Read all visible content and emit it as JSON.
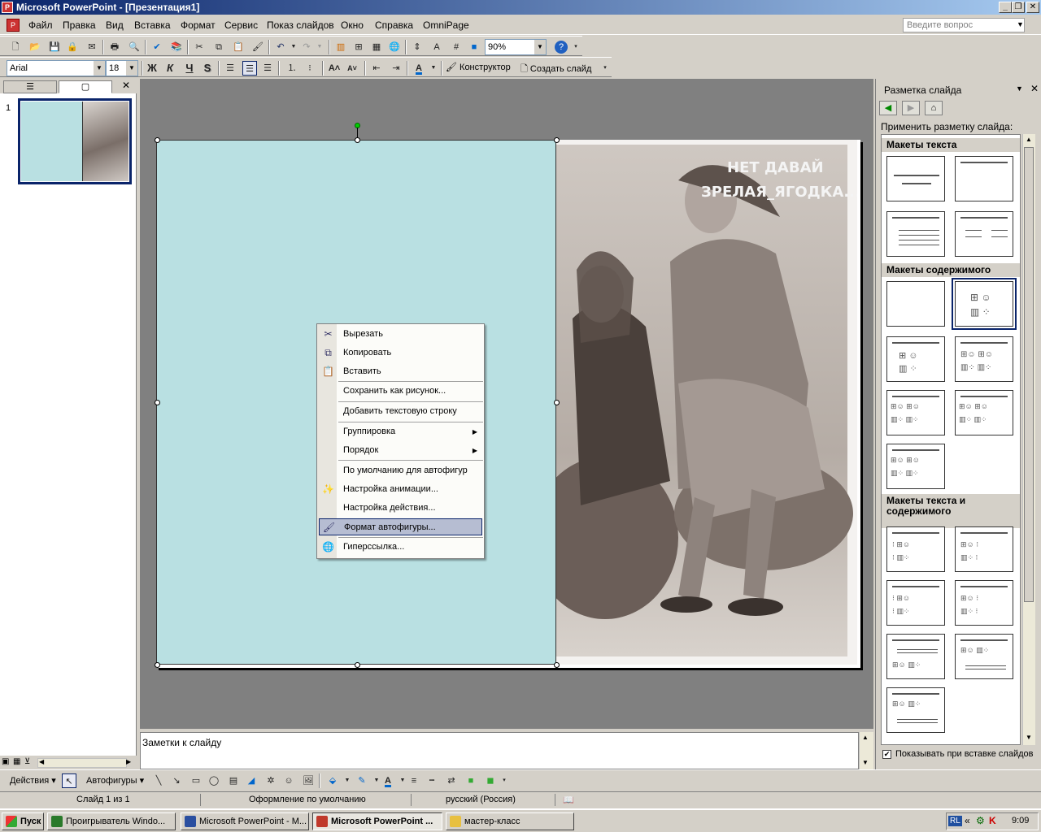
{
  "window": {
    "title": "Microsoft PowerPoint - [Презентация1]",
    "controls": [
      "_",
      "❐",
      "✕"
    ]
  },
  "menubar": {
    "items": [
      "Файл",
      "Правка",
      "Вид",
      "Вставка",
      "Формат",
      "Сервис",
      "Показ слайдов",
      "Окно",
      "Справка",
      "OmniPage"
    ],
    "ask_placeholder": "Введите вопрос",
    "doc_controls": [
      "_",
      "❐",
      "✕"
    ]
  },
  "toolbar_standard": {
    "zoom": "90%"
  },
  "toolbar_format": {
    "font": "Arial",
    "size": "18",
    "bold": "Ж",
    "italic": "К",
    "underline": "Ч",
    "shadow": "S",
    "designer": "Конструктор",
    "new_slide": "Создать слайд"
  },
  "slides_pane": {
    "slide_number": "1"
  },
  "slide": {
    "caption_line1": "НЕТ ДАВАЙ",
    "caption_line2": "ЗРЕЛАЯ_ЯГОДКА..."
  },
  "context_menu": {
    "items": [
      {
        "label": "Вырезать",
        "icon": "cut-icon"
      },
      {
        "label": "Копировать",
        "icon": "copy-icon"
      },
      {
        "label": "Вставить",
        "icon": "paste-icon"
      },
      {
        "label": "Сохранить как рисунок...",
        "icon": ""
      },
      {
        "label": "Добавить текстовую строку",
        "icon": ""
      },
      {
        "label": "Группировка",
        "icon": "",
        "submenu": true
      },
      {
        "label": "Порядок",
        "icon": "",
        "submenu": true
      },
      {
        "label": "По умолчанию для автофигур",
        "icon": ""
      },
      {
        "label": "Настройка анимации...",
        "icon": "animation-icon"
      },
      {
        "label": "Настройка действия...",
        "icon": ""
      },
      {
        "label": "Формат автофигуры...",
        "icon": "format-shape-icon",
        "selected": true
      },
      {
        "label": "Гиперссылка...",
        "icon": "hyperlink-icon"
      }
    ]
  },
  "notes": {
    "placeholder": "Заметки к слайду"
  },
  "task_pane": {
    "title": "Разметка слайда",
    "apply_label": "Применить разметку слайда:",
    "section_text": "Макеты текста",
    "section_content": "Макеты содержимого",
    "section_text_content": "Макеты текста и содержимого",
    "show_on_insert": "Показывать при вставке слайдов"
  },
  "drawing_toolbar": {
    "actions": "Действия",
    "autoshapes": "Автофигуры"
  },
  "statusbar": {
    "slide_info": "Слайд 1 из 1",
    "design": "Оформление по умолчанию",
    "language": "русский (Россия)"
  },
  "taskbar": {
    "start": "Пуск",
    "buttons": [
      {
        "label": "Проигрыватель Windo...",
        "active": false,
        "color": "#2a7a2a"
      },
      {
        "label": "Microsoft PowerPoint - М...",
        "active": false,
        "color": "#2a4fa0"
      },
      {
        "label": "Microsoft PowerPoint ...",
        "active": true,
        "color": "#c0392b"
      },
      {
        "label": "мастер-класс",
        "active": false,
        "color": "#e8c040"
      }
    ],
    "lang": "RL",
    "clock": "9:09"
  },
  "colors": {
    "title_start": "#0a246a",
    "title_end": "#a6caf0",
    "shape_fill": "#b9e0e2",
    "menu_highlight": "#b6bdd2"
  }
}
